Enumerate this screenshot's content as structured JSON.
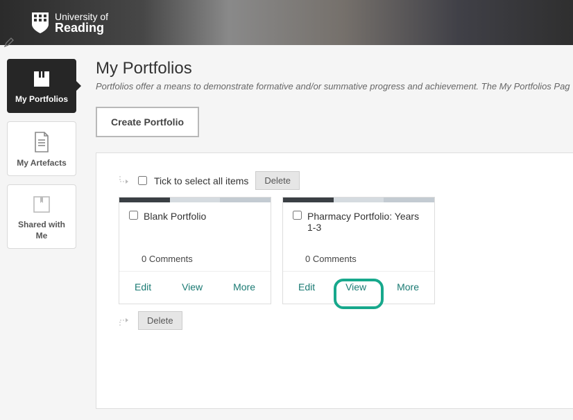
{
  "brand": {
    "line1": "University of",
    "line2": "Reading"
  },
  "sidebar": {
    "items": [
      {
        "label": "My Portfolios"
      },
      {
        "label": "My Artefacts"
      },
      {
        "label": "Shared with Me"
      }
    ]
  },
  "page": {
    "title": "My Portfolios",
    "description": "Portfolios offer a means to demonstrate formative and/or summative progress and achievement. The My Portfolios Pag",
    "create_button": "Create Portfolio",
    "select_all_label": "Tick to select all items",
    "delete_label": "Delete"
  },
  "cards": [
    {
      "title": "Blank Portfolio",
      "comments_count": 0,
      "comments_label": "Comments",
      "actions": {
        "edit": "Edit",
        "view": "View",
        "more": "More"
      }
    },
    {
      "title": "Pharmacy Portfolio: Years 1-3",
      "comments_count": 0,
      "comments_label": "Comments",
      "actions": {
        "edit": "Edit",
        "view": "View",
        "more": "More"
      }
    }
  ]
}
